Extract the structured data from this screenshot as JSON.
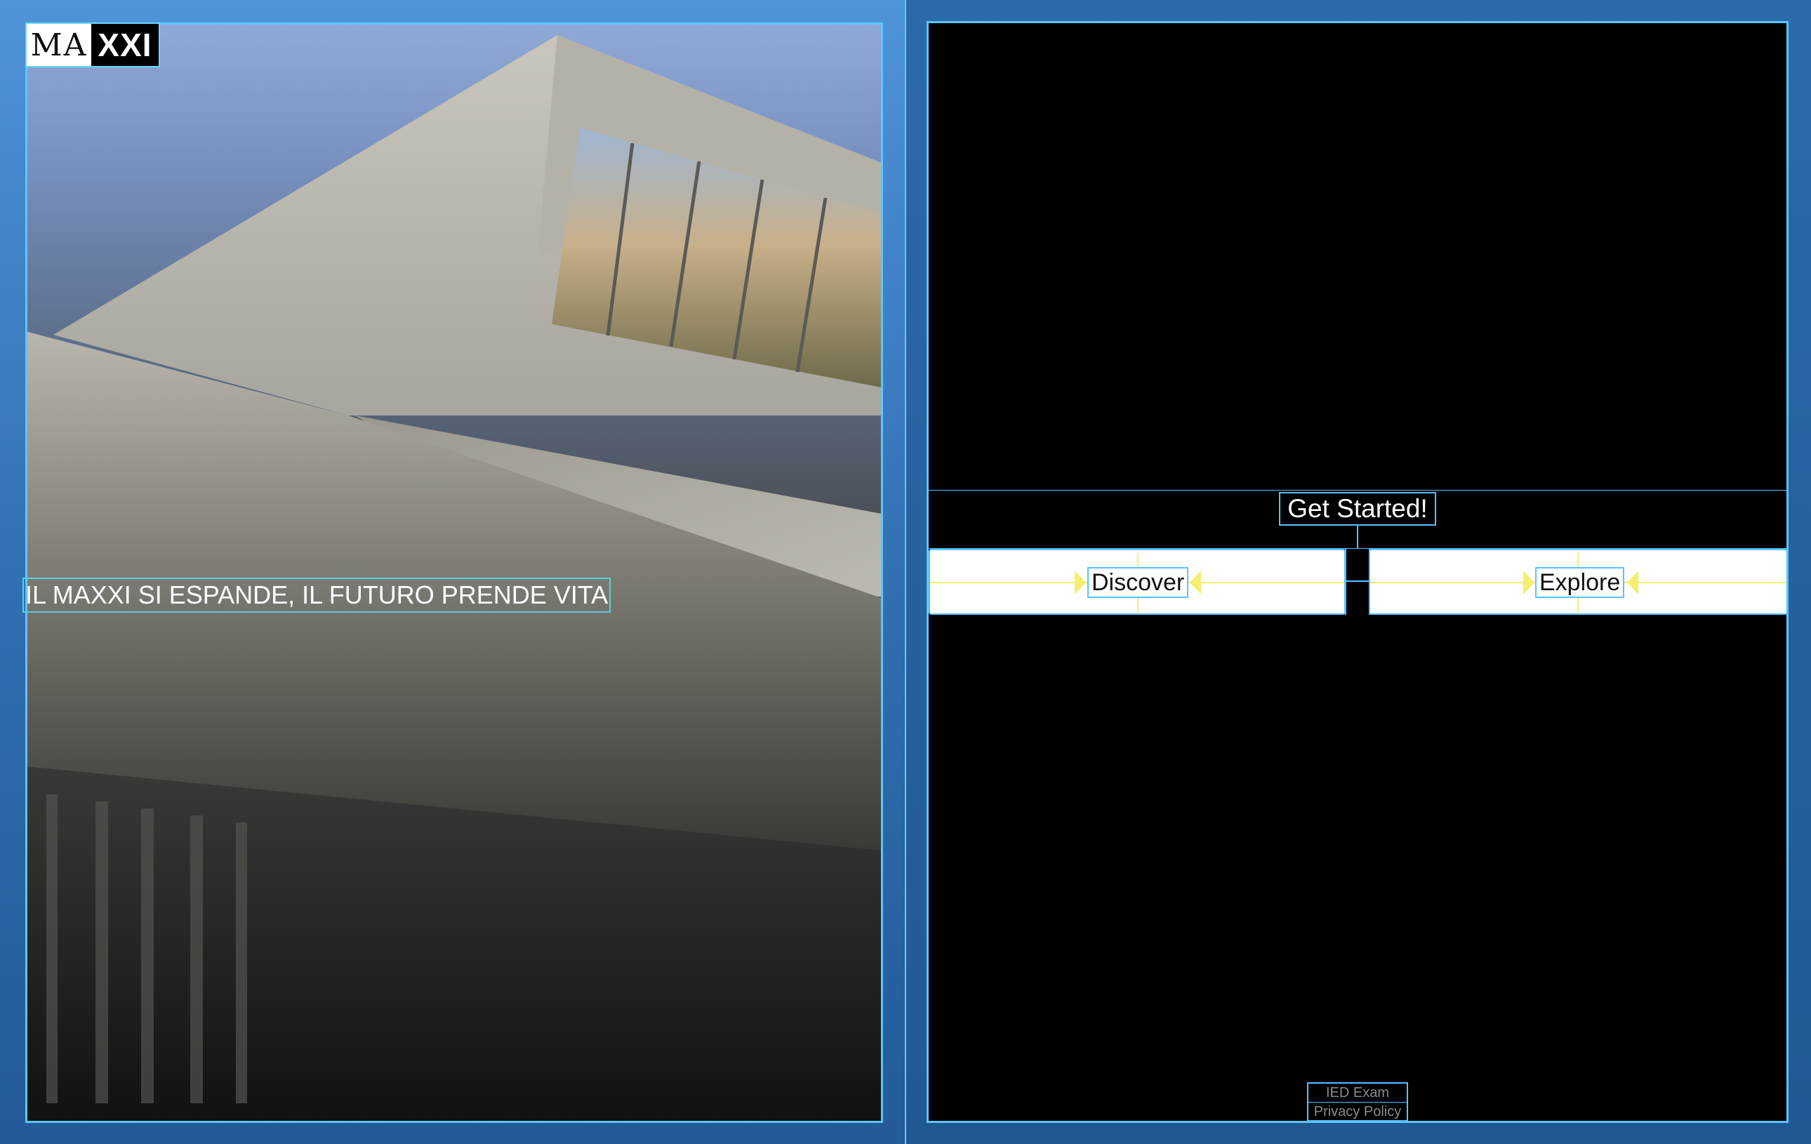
{
  "logo": {
    "part1": "MA",
    "part2": "XXI"
  },
  "hero": {
    "headline": "IL MAXXI SI ESPANDE, IL FUTURO PRENDE VITA"
  },
  "panel": {
    "get_started": "Get Started!",
    "buttons": [
      {
        "label": "Discover"
      },
      {
        "label": "Explore"
      }
    ]
  },
  "footer": {
    "exam": "IED Exam",
    "privacy": "Privacy Policy"
  },
  "colors": {
    "outline": "#58c3ff",
    "guide": "#f4ef70",
    "frame": "#2e6fb0",
    "panel_bg": "#000000"
  }
}
